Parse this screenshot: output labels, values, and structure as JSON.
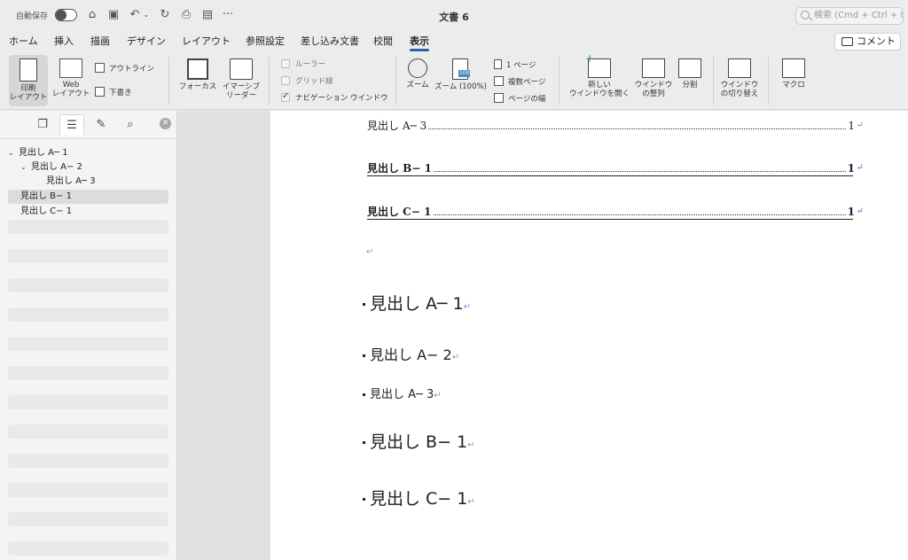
{
  "titlebar": {
    "autosave_label": "自動保存",
    "document_title": "文書 6",
    "search_placeholder": "検索 (Cmd + Ctrl + U)",
    "more_label": "···"
  },
  "tabs": [
    {
      "label": "ホーム"
    },
    {
      "label": "挿入"
    },
    {
      "label": "描画"
    },
    {
      "label": "デザイン"
    },
    {
      "label": "レイアウト"
    },
    {
      "label": "参照設定"
    },
    {
      "label": "差し込み文書"
    },
    {
      "label": "校閲"
    },
    {
      "label": "表示",
      "active": true
    }
  ],
  "comment_button": "コメント",
  "ribbon": {
    "print_layout": [
      "印刷",
      "レイアウト"
    ],
    "web_layout": [
      "Web",
      "レイアウト"
    ],
    "outline": "アウトライン",
    "draft": "下書き",
    "focus": "フォーカス",
    "immersive_reader": [
      "イマーシブ",
      "リーダー"
    ],
    "ruler": "ルーラー",
    "gridlines": "グリッド線",
    "navigation_pane": "ナビゲーション ウインドウ",
    "zoom": "ズーム",
    "zoom_100": "ズーム (100%)",
    "one_page": "1 ページ",
    "multiple_pages": "複数ページ",
    "page_width": "ページの幅",
    "new_window": [
      "新しい",
      "ウインドウを開く"
    ],
    "arrange_all": [
      "ウインドウ",
      "の整列"
    ],
    "split": "分割",
    "switch_windows": [
      "ウインドウ",
      "の切り替え"
    ],
    "macros": "マクロ",
    "zoom_badge": "100"
  },
  "navigation": {
    "items": [
      {
        "label": "見出し A─ 1",
        "level": 0,
        "expanded": true
      },
      {
        "label": "見出し A− 2",
        "level": 1,
        "expanded": true
      },
      {
        "label": "見出し A─ 3",
        "level": 2
      },
      {
        "label": "見出し B− 1",
        "level": 0,
        "selected": true
      },
      {
        "label": "見出し C− 1",
        "level": 0
      }
    ]
  },
  "document": {
    "toc": [
      {
        "label": "見出し A─ 3",
        "page": "1",
        "bold": false
      },
      {
        "label": "見出し B− 1",
        "page": "1",
        "bold": true
      },
      {
        "label": "見出し C− 1",
        "page": "1",
        "bold": true
      }
    ],
    "return_mark": "↵",
    "headings": [
      {
        "text": "見出し A─ 1",
        "level": 1
      },
      {
        "text": "見出し A− 2",
        "level": 2
      },
      {
        "text": "見出し A─ 3",
        "level": 3
      },
      {
        "text": "見出し B− 1",
        "level": 1
      },
      {
        "text": "見出し C− 1",
        "level": 1
      }
    ]
  }
}
